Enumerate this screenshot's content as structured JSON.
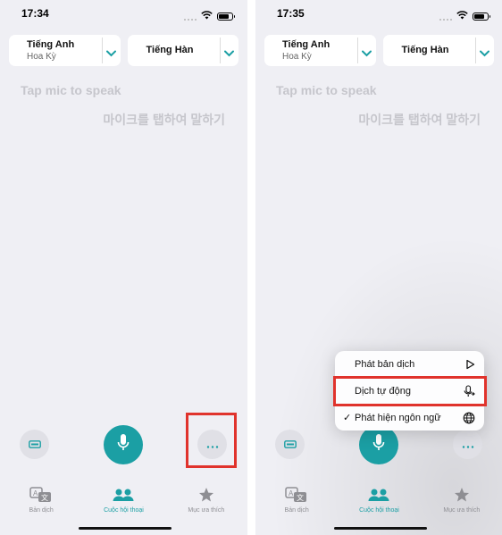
{
  "left": {
    "status_time": "17:34",
    "source_lang": {
      "name": "Tiếng Anh",
      "region": "Hoa Kỳ"
    },
    "target_lang": {
      "name": "Tiếng Hàn"
    },
    "prompt_en": "Tap mic to speak",
    "prompt_ko": "마이크를 탭하여 말하기",
    "tabs": [
      "Bản dịch",
      "Cuộc hội thoại",
      "Mục ưa thích"
    ]
  },
  "right": {
    "status_time": "17:35",
    "source_lang": {
      "name": "Tiếng Anh",
      "region": "Hoa Kỳ"
    },
    "target_lang": {
      "name": "Tiếng Hàn"
    },
    "prompt_en": "Tap mic to speak",
    "prompt_ko": "마이크를 탭하여 말하기",
    "tabs": [
      "Bản dịch",
      "Cuộc hội thoại",
      "Mục ưa thích"
    ],
    "menu": [
      {
        "label": "Phát bản dịch",
        "icon": "play-icon",
        "checked": false
      },
      {
        "label": "Dịch tự động",
        "icon": "auto-mic-icon",
        "checked": false
      },
      {
        "label": "Phát hiện ngôn ngữ",
        "icon": "globe-mic-icon",
        "checked": true
      }
    ],
    "menu_check": "✓"
  },
  "colors": {
    "accent": "#1b9fa4",
    "highlight": "#e0332c",
    "background": "#efeff4"
  },
  "active_tab": "Cuộc hội thoại"
}
